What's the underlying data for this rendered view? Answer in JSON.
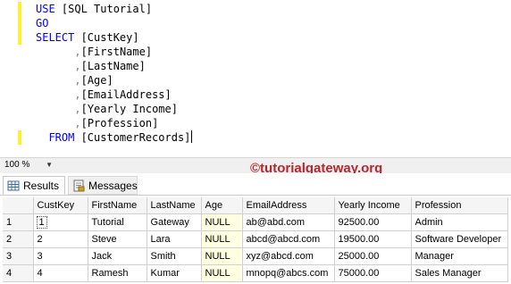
{
  "editor": {
    "lines": [
      {
        "parts": [
          {
            "t": "USE ",
            "c": "kw"
          },
          {
            "t": "[SQL Tutorial]",
            "c": ""
          }
        ]
      },
      {
        "parts": [
          {
            "t": "GO",
            "c": "kw"
          }
        ]
      },
      {
        "parts": [
          {
            "t": "SELECT ",
            "c": "kw"
          },
          {
            "t": "[CustKey]",
            "c": ""
          }
        ]
      },
      {
        "parts": [
          {
            "t": "      ",
            "c": ""
          },
          {
            "t": ",",
            "c": "gray"
          },
          {
            "t": "[FirstName]",
            "c": ""
          }
        ]
      },
      {
        "parts": [
          {
            "t": "      ",
            "c": ""
          },
          {
            "t": ",",
            "c": "gray"
          },
          {
            "t": "[LastName]",
            "c": ""
          }
        ]
      },
      {
        "parts": [
          {
            "t": "      ",
            "c": ""
          },
          {
            "t": ",",
            "c": "gray"
          },
          {
            "t": "[Age]",
            "c": ""
          }
        ]
      },
      {
        "parts": [
          {
            "t": "      ",
            "c": ""
          },
          {
            "t": ",",
            "c": "gray"
          },
          {
            "t": "[EmailAddress]",
            "c": ""
          }
        ]
      },
      {
        "parts": [
          {
            "t": "      ",
            "c": ""
          },
          {
            "t": ",",
            "c": "gray"
          },
          {
            "t": "[Yearly Income]",
            "c": ""
          }
        ]
      },
      {
        "parts": [
          {
            "t": "      ",
            "c": ""
          },
          {
            "t": ",",
            "c": "gray"
          },
          {
            "t": "[Profession]",
            "c": ""
          }
        ]
      },
      {
        "parts": [
          {
            "t": "  FROM ",
            "c": "kw"
          },
          {
            "t": "[CustomerRecords]",
            "c": ""
          }
        ]
      }
    ]
  },
  "statusbar": {
    "zoom": "100 %",
    "zoom_arrow": "▼"
  },
  "watermark": "©tutorialgateway.org",
  "tabs": [
    {
      "label": "Results",
      "icon": "results-grid-icon"
    },
    {
      "label": "Messages",
      "icon": "messages-icon"
    }
  ],
  "grid": {
    "columns": [
      "",
      "CustKey",
      "FirstName",
      "LastName",
      "Age",
      "EmailAddress",
      "Yearly Income",
      "Profession"
    ],
    "rows": [
      [
        "1",
        "1",
        "Tutorial",
        "Gateway",
        "NULL",
        "ab@abd.com",
        "92500.00",
        "Admin"
      ],
      [
        "2",
        "2",
        "Steve",
        "Lara",
        "NULL",
        "abcd@abcd.com",
        "19500.00",
        "Software Developer"
      ],
      [
        "3",
        "3",
        "Jack",
        "Smith",
        "NULL",
        "xyz@abcd.com",
        "25000.00",
        "Manager"
      ],
      [
        "4",
        "4",
        "Ramesh",
        "Kumar",
        "NULL",
        "mnopq@abcs.com",
        "75000.00",
        "Sales Manager"
      ]
    ]
  },
  "colors": {
    "keyword": "#0000ff",
    "watermark": "#b5272d",
    "null_cell": "#ffffe1",
    "change_marker": "#fcef36"
  }
}
